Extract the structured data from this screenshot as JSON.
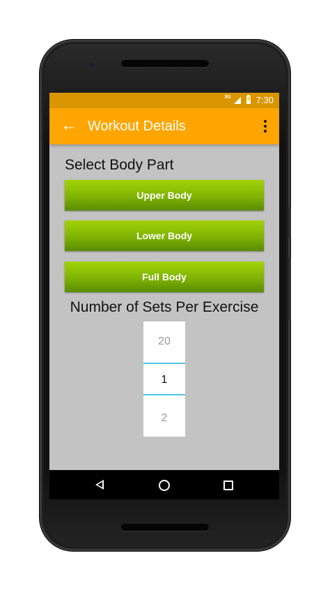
{
  "status_bar": {
    "network": "3G",
    "time": "7:30"
  },
  "toolbar": {
    "title": "Workout Details",
    "back_icon": "arrow-left-icon",
    "menu_icon": "overflow-menu-icon"
  },
  "body_part": {
    "heading": "Select Body Part",
    "buttons": [
      "Upper Body",
      "Lower Body",
      "Full Body"
    ]
  },
  "sets": {
    "heading": "Number of Sets Per Exercise",
    "picker": {
      "previous": "20",
      "selected": "1",
      "next": "2"
    }
  },
  "colors": {
    "status_bar": "#d99600",
    "toolbar": "#ffa500",
    "button_green": "#7fb204",
    "background": "#c3c3c3",
    "picker_divider": "#4fc3e8"
  }
}
